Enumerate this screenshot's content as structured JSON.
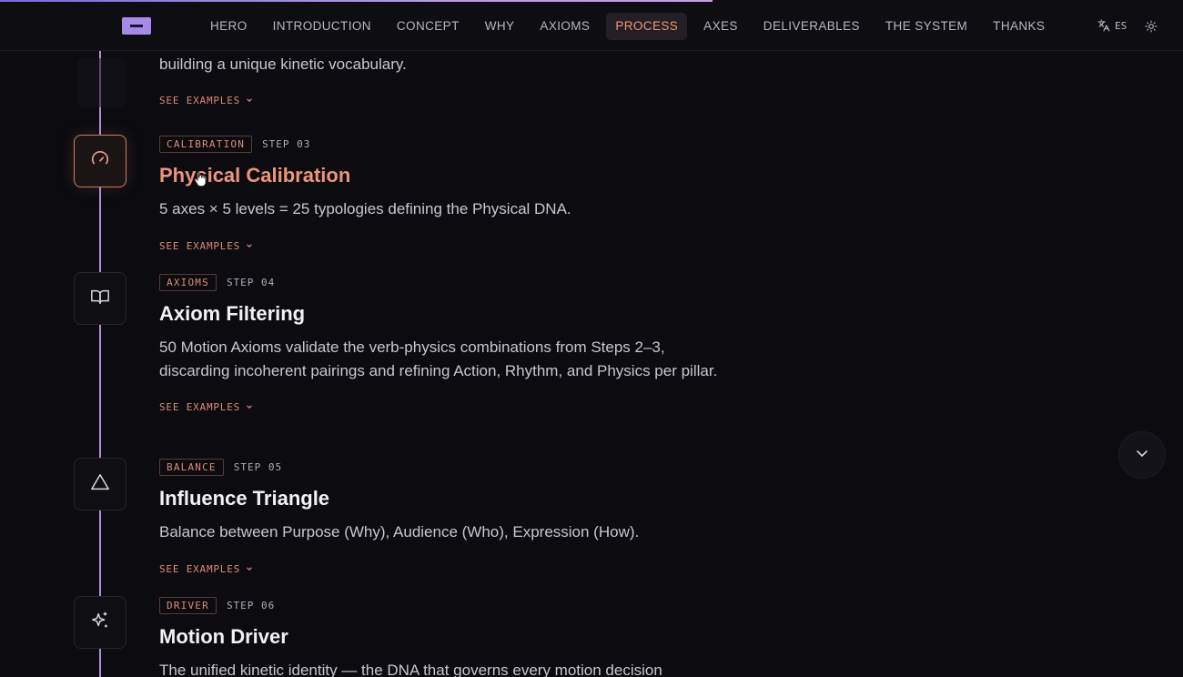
{
  "nav": {
    "links": [
      "HERO",
      "INTRODUCTION",
      "CONCEPT",
      "WHY",
      "AXIOMS",
      "PROCESS",
      "AXES",
      "DELIVERABLES",
      "THE SYSTEM",
      "THANKS"
    ],
    "active": "PROCESS",
    "language": "ES",
    "language_icon": "translate-icon",
    "theme_icon": "sun-icon"
  },
  "intro_fragment": {
    "text": "building a unique kinetic vocabulary.",
    "see_examples": "SEE EXAMPLES"
  },
  "steps": [
    {
      "tag": "CALIBRATION",
      "step": "STEP 03",
      "title": "Physical Calibration",
      "description": "5 axes × 5 levels = 25 typologies defining the Physical DNA.",
      "see_examples": "SEE EXAMPLES",
      "icon": "gauge-icon"
    },
    {
      "tag": "AXIOMS",
      "step": "STEP 04",
      "title": "Axiom Filtering",
      "description": "50 Motion Axioms validate the verb-physics combinations from Steps 2–3, discarding incoherent pairings and refining Action, Rhythm, and Physics per pillar.",
      "see_examples": "SEE EXAMPLES",
      "icon": "book-icon"
    },
    {
      "tag": "BALANCE",
      "step": "STEP 05",
      "title": "Influence Triangle",
      "description": "Balance between Purpose (Why), Audience (Who), Expression (How).",
      "see_examples": "SEE EXAMPLES",
      "icon": "triangle-icon"
    },
    {
      "tag": "DRIVER",
      "step": "STEP 06",
      "title": "Motion Driver",
      "description": "The unified kinetic identity — the DNA that governs every motion decision",
      "icon": "sparkles-icon"
    }
  ],
  "colors": {
    "accent": "#ef9479",
    "timeline": "#b58bd6",
    "background": "#0b0b10"
  }
}
